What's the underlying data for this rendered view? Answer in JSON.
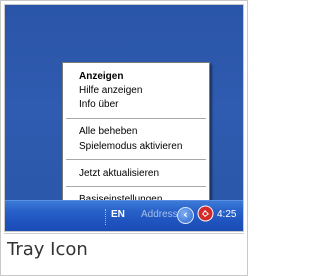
{
  "menu": {
    "items": [
      {
        "label": "Anzeigen",
        "bold": true
      },
      {
        "label": "Hilfe anzeigen",
        "bold": false
      },
      {
        "label": "Info über",
        "bold": false
      },
      {
        "label": "Alle beheben",
        "bold": false
      },
      {
        "label": "Spielemodus aktivieren",
        "bold": false
      },
      {
        "label": "Jetzt aktualisieren",
        "bold": false
      },
      {
        "label": "Basiseinstellungen",
        "bold": false
      }
    ]
  },
  "taskbar": {
    "language": "EN",
    "address_label": "Address",
    "chevron_icon": "chevron-left-icon",
    "app_icon": "security-tray-icon",
    "clock": "4:25"
  },
  "caption": "Tray Icon",
  "colors": {
    "desktop": "#2f5bb0",
    "taskbar": "#2962c9",
    "menu_background": "#ffffff",
    "menu_border": "#7a7a7a",
    "app_icon_red": "#d42a2a"
  }
}
